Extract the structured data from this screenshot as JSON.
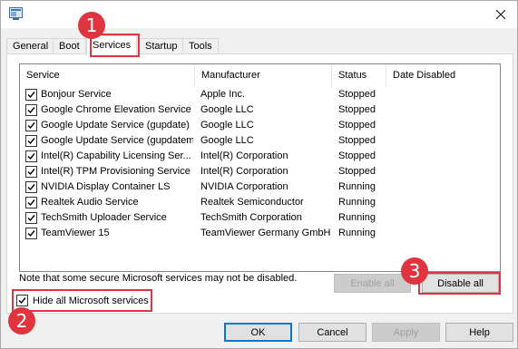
{
  "tabs": [
    {
      "label": "General"
    },
    {
      "label": "Boot"
    },
    {
      "label": "Services",
      "active": true
    },
    {
      "label": "Startup"
    },
    {
      "label": "Tools"
    }
  ],
  "columns": {
    "service": "Service",
    "manufacturer": "Manufacturer",
    "status": "Status",
    "date_disabled": "Date Disabled"
  },
  "services": [
    {
      "name": "Bonjour Service",
      "manufacturer": "Apple Inc.",
      "status": "Stopped",
      "date_disabled": "",
      "checked": true
    },
    {
      "name": "Google Chrome Elevation Service",
      "manufacturer": "Google LLC",
      "status": "Stopped",
      "date_disabled": "",
      "checked": true
    },
    {
      "name": "Google Update Service (gupdate)",
      "manufacturer": "Google LLC",
      "status": "Stopped",
      "date_disabled": "",
      "checked": true
    },
    {
      "name": "Google Update Service (gupdatem)",
      "manufacturer": "Google LLC",
      "status": "Stopped",
      "date_disabled": "",
      "checked": true
    },
    {
      "name": "Intel(R) Capability Licensing Ser...",
      "manufacturer": "Intel(R) Corporation",
      "status": "Stopped",
      "date_disabled": "",
      "checked": true
    },
    {
      "name": "Intel(R) TPM Provisioning Service",
      "manufacturer": "Intel(R) Corporation",
      "status": "Stopped",
      "date_disabled": "",
      "checked": true
    },
    {
      "name": "NVIDIA Display Container LS",
      "manufacturer": "NVIDIA Corporation",
      "status": "Running",
      "date_disabled": "",
      "checked": true
    },
    {
      "name": "Realtek Audio Service",
      "manufacturer": "Realtek Semiconductor",
      "status": "Running",
      "date_disabled": "",
      "checked": true
    },
    {
      "name": "TechSmith Uploader Service",
      "manufacturer": "TechSmith Corporation",
      "status": "Running",
      "date_disabled": "",
      "checked": true
    },
    {
      "name": "TeamViewer 15",
      "manufacturer": "TeamViewer Germany GmbH",
      "status": "Running",
      "date_disabled": "",
      "checked": true
    }
  ],
  "note": "Note that some secure Microsoft services may not be disabled.",
  "buttons": {
    "enable_all": "Enable all",
    "disable_all": "Disable all",
    "ok": "OK",
    "cancel": "Cancel",
    "apply": "Apply",
    "help": "Help"
  },
  "hide_ms": {
    "label": "Hide all Microsoft services",
    "checked": true
  },
  "annotations": {
    "step1": "1",
    "step2": "2",
    "step3": "3"
  },
  "colors": {
    "highlight": "#e0353e",
    "focus": "#0078d7"
  },
  "icons": {
    "app": "msconfig-icon",
    "close": "close-icon",
    "check": "checkmark-icon"
  }
}
